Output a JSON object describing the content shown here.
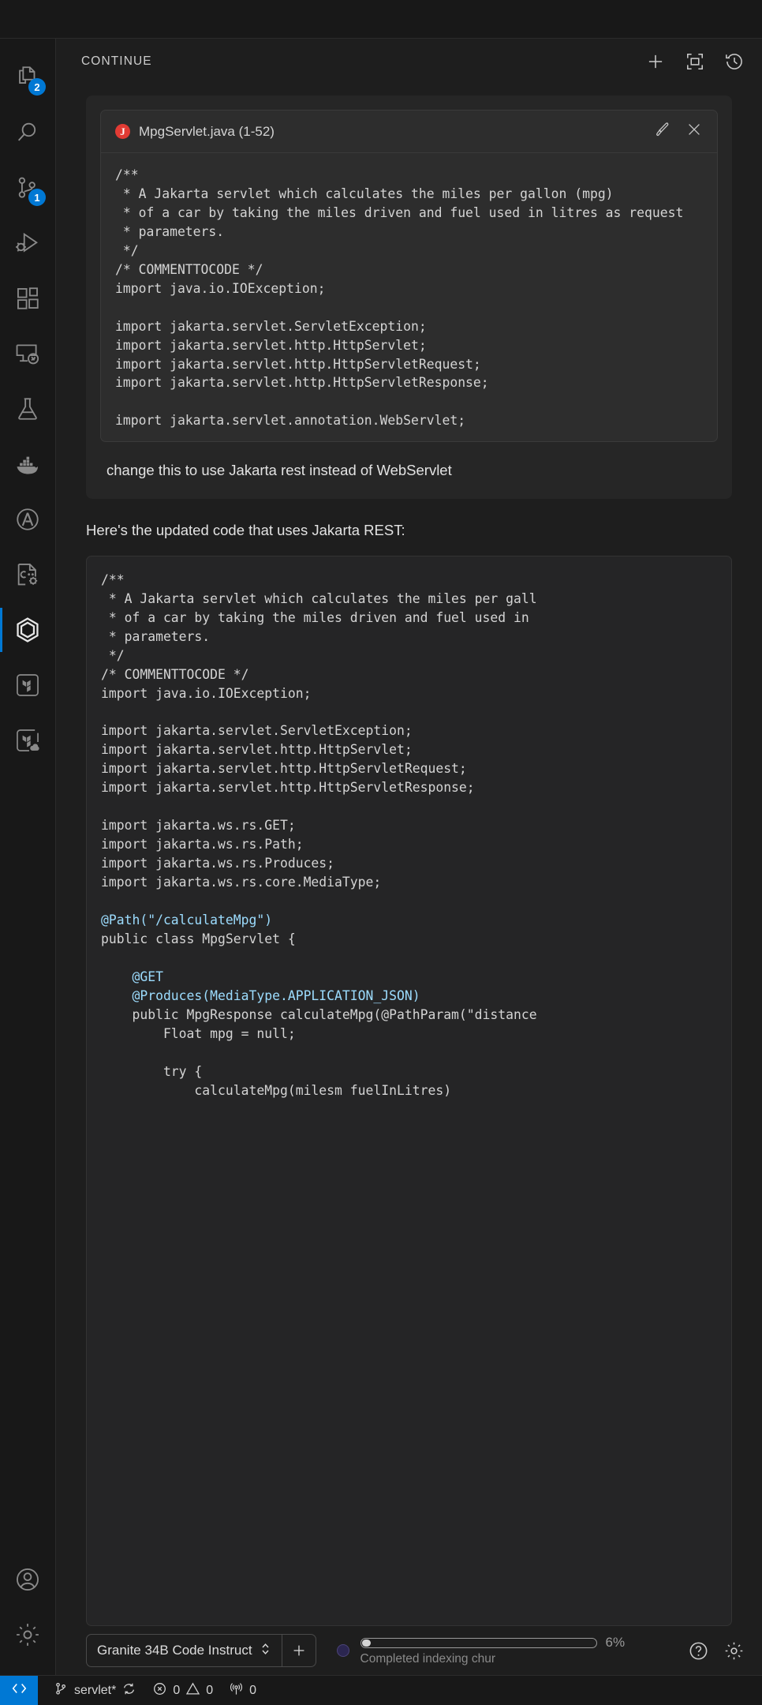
{
  "activity_bar": {
    "top_items": [
      {
        "name": "explorer",
        "icon": "files-icon",
        "badge": "2"
      },
      {
        "name": "search",
        "icon": "search-icon",
        "badge": null
      },
      {
        "name": "source-control",
        "icon": "source-control-icon",
        "badge": "1"
      },
      {
        "name": "run-and-debug",
        "icon": "run-debug-icon",
        "badge": null
      },
      {
        "name": "extensions",
        "icon": "extensions-icon",
        "badge": null
      },
      {
        "name": "remote-explorer",
        "icon": "remote-explorer-icon",
        "badge": null
      },
      {
        "name": "testing",
        "icon": "testing-flask-icon",
        "badge": null
      },
      {
        "name": "docker",
        "icon": "docker-whale-icon",
        "badge": null
      },
      {
        "name": "ansible",
        "icon": "ansible-icon",
        "badge": null
      },
      {
        "name": "cpp-tools",
        "icon": "cpp-file-gear-icon",
        "badge": null
      },
      {
        "name": "continue",
        "icon": "continue-hexagon-icon",
        "badge": null,
        "active": true
      },
      {
        "name": "terraform",
        "icon": "terraform-icon",
        "badge": null
      },
      {
        "name": "terraform-cloud",
        "icon": "terraform-cloud-icon",
        "badge": null
      }
    ],
    "bottom_items": [
      {
        "name": "accounts",
        "icon": "account-icon"
      },
      {
        "name": "manage-settings",
        "icon": "gear-icon"
      }
    ]
  },
  "panel": {
    "title": "CONTINUE",
    "actions": [
      {
        "name": "new-session-button",
        "icon": "plus-icon"
      },
      {
        "name": "expand-panel-button",
        "icon": "expand-icon"
      },
      {
        "name": "history-button",
        "icon": "history-icon"
      }
    ]
  },
  "conversation": {
    "user_message": {
      "context_card": {
        "file_icon": "java-file-icon",
        "file_icon_letter": "J",
        "filename": "MpgServlet.java (1-52)",
        "actions": [
          {
            "name": "edit-context-button",
            "icon": "paintbrush-icon"
          },
          {
            "name": "remove-context-button",
            "icon": "close-icon"
          }
        ],
        "code": "/**\n * A Jakarta servlet which calculates the miles per gallon (mpg)\n * of a car by taking the miles driven and fuel used in litres as request\n * parameters.\n */\n/* COMMENTTOCODE */\nimport java.io.IOException;\n\nimport jakarta.servlet.ServletException;\nimport jakarta.servlet.http.HttpServlet;\nimport jakarta.servlet.http.HttpServletRequest;\nimport jakarta.servlet.http.HttpServletResponse;\n\nimport jakarta.servlet.annotation.WebServlet;"
      },
      "text": "change this to use Jakarta rest instead of WebServlet"
    },
    "assistant_message": {
      "text": "Here's the updated code that uses Jakarta REST:",
      "code_lines": [
        {
          "text": "/**",
          "cls": "c-cm"
        },
        {
          "text": " * A Jakarta servlet which calculates the miles per gall",
          "cls": "c-cm"
        },
        {
          "text": " * of a car by taking the miles driven and fuel used in",
          "cls": "c-cm"
        },
        {
          "text": " * parameters.",
          "cls": "c-cm"
        },
        {
          "text": " */",
          "cls": "c-cm"
        },
        {
          "text": "/* COMMENTTOCODE */",
          "cls": "c-cm"
        },
        {
          "text": "import java.io.IOException;",
          "cls": "c-kw"
        },
        {
          "text": "",
          "cls": "c-kw"
        },
        {
          "text": "import jakarta.servlet.ServletException;",
          "cls": "c-kw"
        },
        {
          "text": "import jakarta.servlet.http.HttpServlet;",
          "cls": "c-kw"
        },
        {
          "text": "import jakarta.servlet.http.HttpServletRequest;",
          "cls": "c-kw"
        },
        {
          "text": "import jakarta.servlet.http.HttpServletResponse;",
          "cls": "c-kw"
        },
        {
          "text": "",
          "cls": "c-kw"
        },
        {
          "text": "import jakarta.ws.rs.GET;",
          "cls": "c-kw"
        },
        {
          "text": "import jakarta.ws.rs.Path;",
          "cls": "c-kw"
        },
        {
          "text": "import jakarta.ws.rs.Produces;",
          "cls": "c-kw"
        },
        {
          "text": "import jakarta.ws.rs.core.MediaType;",
          "cls": "c-kw"
        },
        {
          "text": "",
          "cls": "c-kw"
        },
        {
          "text": "@Path(\"/calculateMpg\")",
          "cls": "c-an"
        },
        {
          "text": "public class MpgServlet {",
          "cls": "c-kw"
        },
        {
          "text": "",
          "cls": "c-kw"
        },
        {
          "text": "    @GET",
          "cls": "c-an"
        },
        {
          "text": "    @Produces(MediaType.APPLICATION_JSON)",
          "cls": "c-an"
        },
        {
          "text": "    public MpgResponse calculateMpg(@PathParam(\"distance",
          "cls": "c-kw"
        },
        {
          "text": "        Float mpg = null;",
          "cls": "c-kw"
        },
        {
          "text": "",
          "cls": "c-kw"
        },
        {
          "text": "        try {",
          "cls": "c-kw"
        },
        {
          "text": "            calculateMpg(milesm fuelInLitres)",
          "cls": "c-kw"
        }
      ]
    }
  },
  "input_toolbar": {
    "model_name": "Granite 34B Code Instruct",
    "model_dropdown_icon": "chevron-updown-icon",
    "add_button_icon": "plus-icon",
    "status_dot": "status-dot-indicator",
    "progress_percent": "6%",
    "progress_value": 6,
    "progress_label": "Completed indexing chur",
    "help_icon": "help-circle-icon",
    "settings_icon": "gear-icon"
  },
  "status_bar": {
    "remote_icon": "remote-window-icon",
    "branch_icon": "source-control-icon",
    "branch": "servlet*",
    "sync_icon": "sync-icon",
    "errors_icon": "error-circle-icon",
    "errors": "0",
    "warnings_icon": "warning-triangle-icon",
    "warnings": "0",
    "radio_icon": "radio-tower-icon",
    "radio_count": "0"
  },
  "colors": {
    "accent": "#0078d4",
    "panel_bg": "#1e1e1e",
    "activity_bg": "#181818",
    "card_bg": "#2d2d2d",
    "java_red": "#e23b34",
    "code_annotation": "#9cdcfe",
    "code_function": "#dcdcaa"
  }
}
